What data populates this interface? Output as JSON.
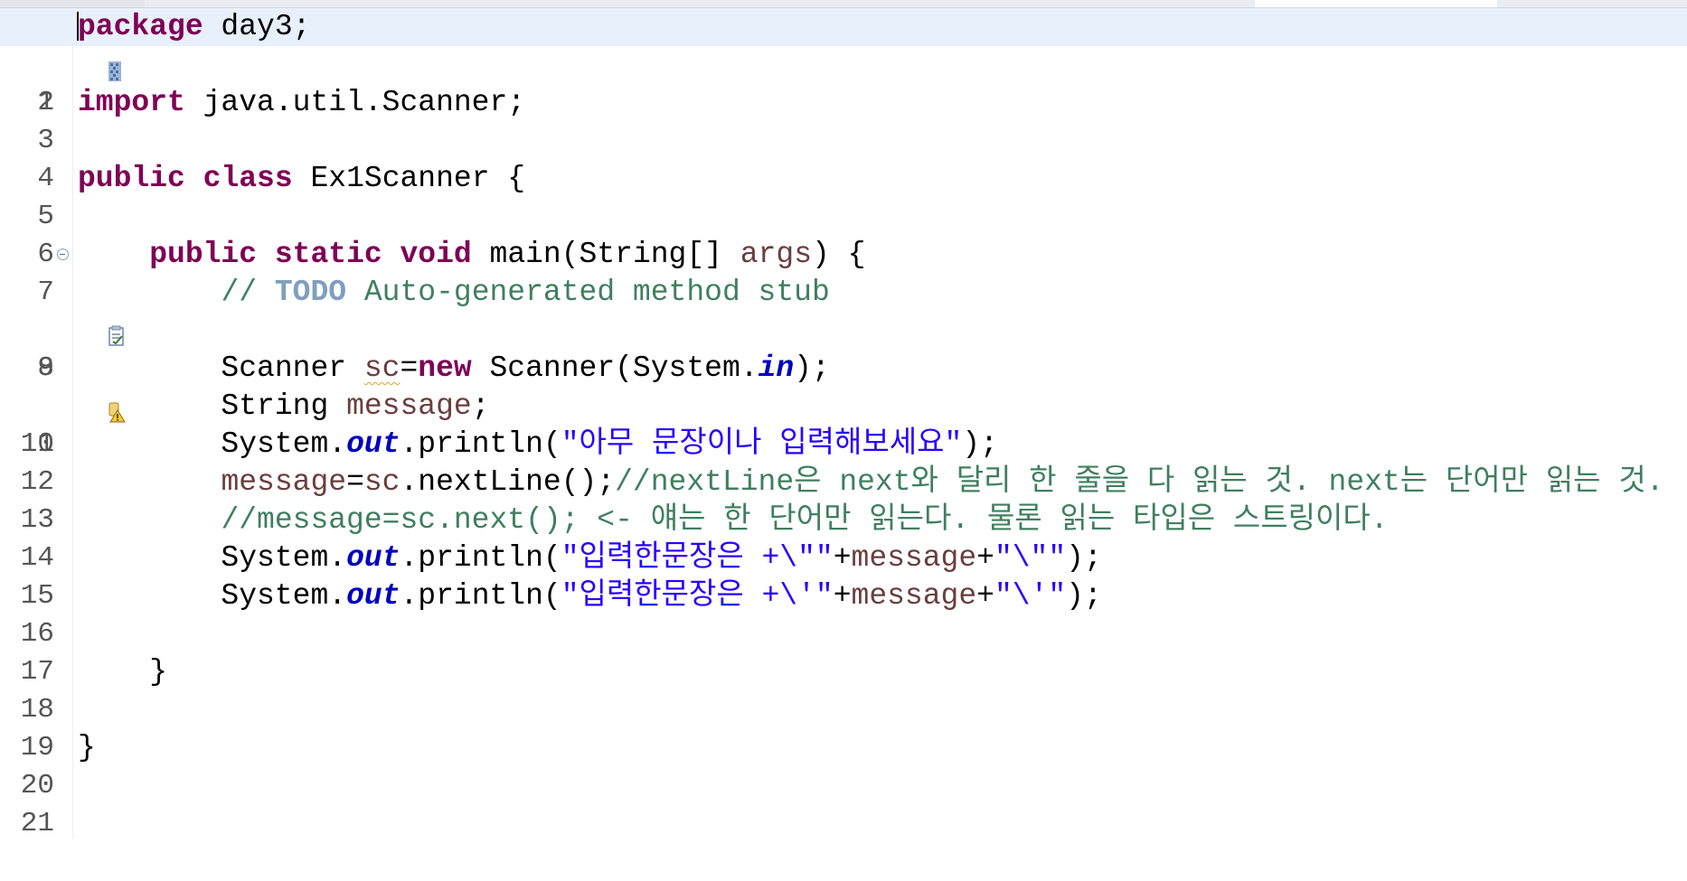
{
  "editor": {
    "lines": [
      {
        "num": "1",
        "t1": "package",
        "t2": " day3;"
      },
      {
        "num": "2"
      },
      {
        "num": "3",
        "t1": "import",
        "t2": " java.util.Scanner;"
      },
      {
        "num": "4"
      },
      {
        "num": "5",
        "t1": "public",
        "t2": " ",
        "t3": "class",
        "t4": " Ex1Scanner {"
      },
      {
        "num": "6"
      },
      {
        "num": "7",
        "t1": "    ",
        "t2": "public",
        "t3": " ",
        "t4": "static",
        "t5": " ",
        "t6": "void",
        "t7": " main(String[] ",
        "t8": "args",
        "t9": ") {"
      },
      {
        "num": "8",
        "t1": "        ",
        "t2": "// ",
        "t3": "TODO",
        "t4": " Auto-generated method stub"
      },
      {
        "num": "9"
      },
      {
        "num": "10",
        "t1": "        Scanner ",
        "t2": "sc",
        "t3": "=",
        "t4": "new",
        "t5": " Scanner(System.",
        "t6": "in",
        "t7": ");"
      },
      {
        "num": "11",
        "t1": "        String ",
        "t2": "message",
        "t3": ";"
      },
      {
        "num": "12",
        "t1": "        System.",
        "t2": "out",
        "t3": ".println(",
        "t4": "\"아무 문장이나 입력해보세요\"",
        "t5": ");"
      },
      {
        "num": "13",
        "t1": "        ",
        "t2": "message",
        "t3": "=",
        "t4": "sc",
        "t5": ".nextLine();",
        "t6": "//nextLine은 next와 달리 한 줄을 다 읽는 것. next는 단어만 읽는 것."
      },
      {
        "num": "14",
        "t1": "        ",
        "t2": "//message=sc.next(); <- 얘는 한 단어만 읽는다. 물론 읽는 타입은 스트링이다."
      },
      {
        "num": "15",
        "t1": "        System.",
        "t2": "out",
        "t3": ".println(",
        "t4": "\"입력한문장은 +\\\"\"",
        "t5": "+",
        "t6": "message",
        "t7": "+",
        "t8": "\"\\\"\"",
        "t9": ");"
      },
      {
        "num": "16",
        "t1": "        System.",
        "t2": "out",
        "t3": ".println(",
        "t4": "\"입력한문장은 +\\'\"",
        "t5": "+",
        "t6": "message",
        "t7": "+",
        "t8": "\"\\'\"",
        "t9": ");"
      },
      {
        "num": "17"
      },
      {
        "num": "18",
        "t1": "    }"
      },
      {
        "num": "19"
      },
      {
        "num": "20",
        "t1": "}"
      },
      {
        "num": "21"
      }
    ]
  },
  "colors": {
    "keyword": "#7f0055",
    "string": "#2a00ff",
    "comment": "#3f7f5f",
    "todo_tag": "#7f9fbf",
    "static_field": "#0000c0",
    "local_variable": "#6a3e3e",
    "current_line": "#e8f0fc"
  },
  "icons": {
    "line1_marker": "bookmark-icon",
    "line7_marker": "fold-collapse-icon",
    "line8_marker": "task-icon",
    "line10_marker": "warning-icon"
  }
}
